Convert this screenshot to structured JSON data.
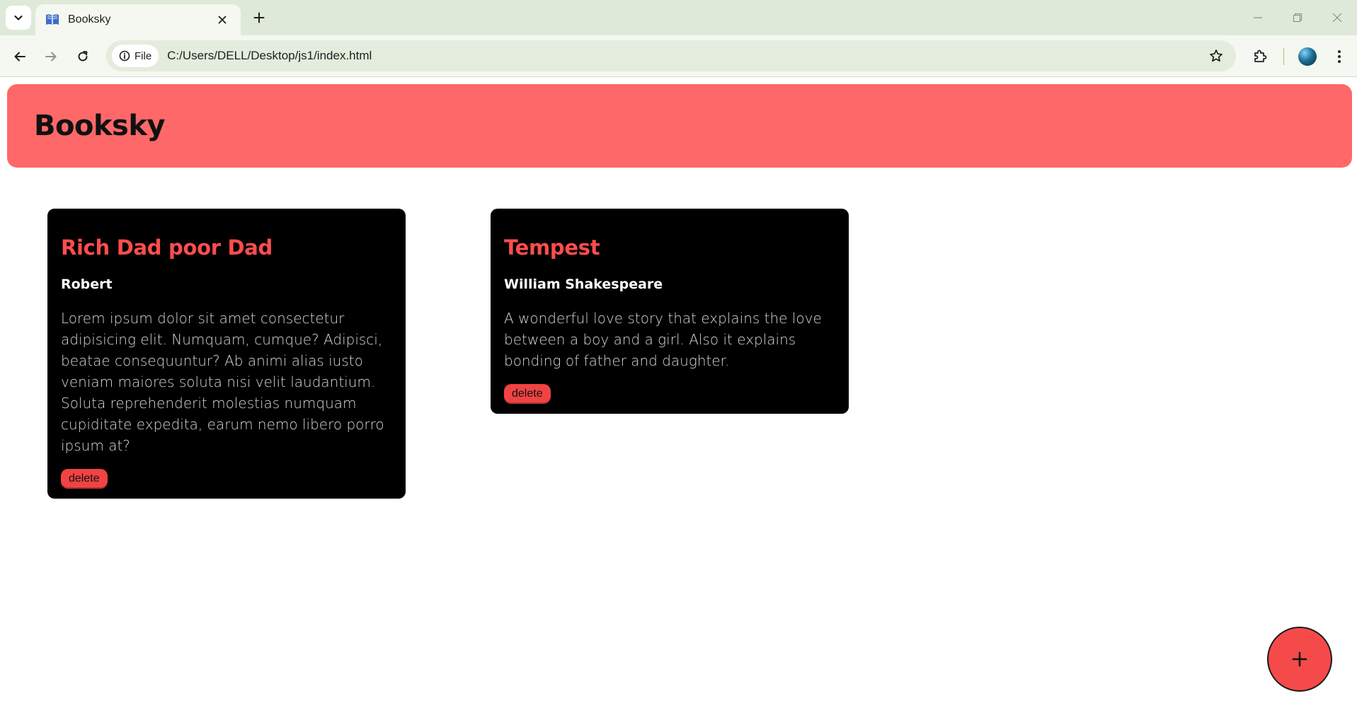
{
  "browser": {
    "tab_title": "Booksky",
    "site_chip_label": "File",
    "url": "C:/Users/DELL/Desktop/js1/index.html"
  },
  "header": {
    "brand": "Booksky"
  },
  "books": [
    {
      "title": "Rich Dad poor Dad",
      "author": "Robert",
      "description": "Lorem ipsum dolor sit amet consectetur adipisicing elit. Numquam, cumque? Adipisci, beatae consequuntur? Ab animi alias iusto veniam maiores soluta nisi velit laudantium. Soluta reprehenderit molestias numquam cupiditate expedita, earum nemo libero porro ipsum at?",
      "delete_label": "delete"
    },
    {
      "title": "Tempest",
      "author": "William Shakespeare",
      "description": "A wonderful love story that explains the love between a boy and a girl. Also it explains bonding of father and daughter.",
      "delete_label": "delete"
    }
  ],
  "fab": {
    "icon": "plus-icon",
    "label": "+"
  },
  "colors": {
    "header_bg": "#ff6868",
    "card_bg": "#000000",
    "card_title": "#ff4d4d",
    "delete_bg": "#f14343",
    "fab_bg": "#f44a4a",
    "chrome_bg": "#dfe9d9"
  }
}
